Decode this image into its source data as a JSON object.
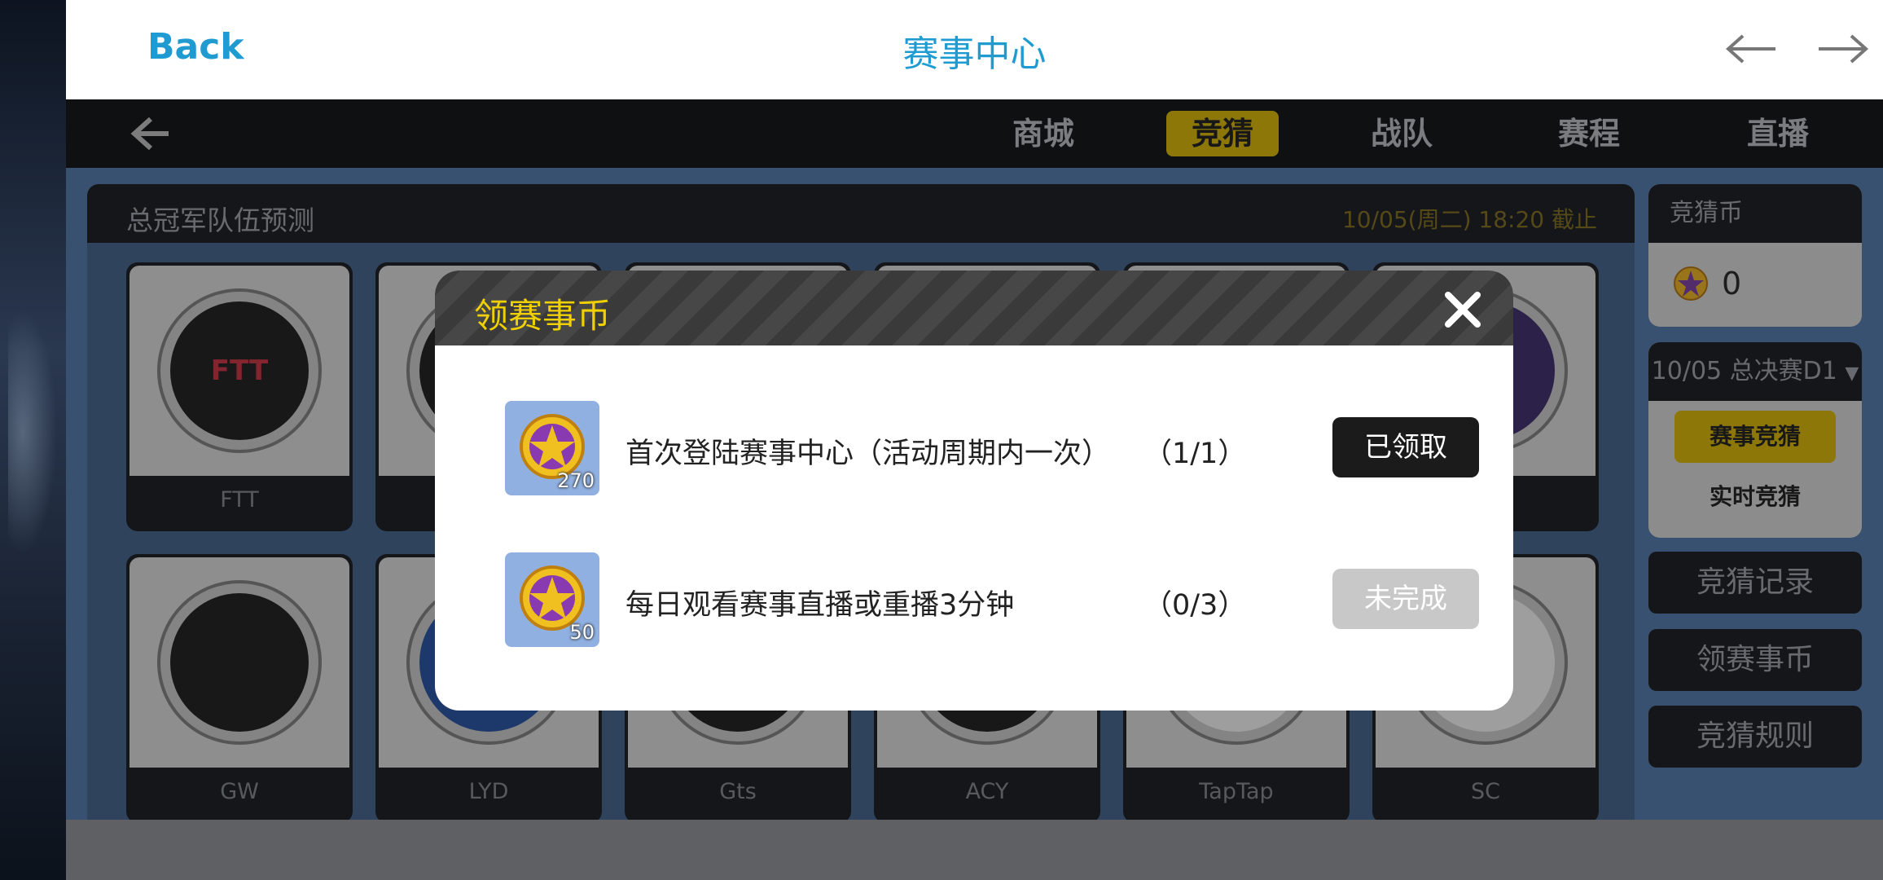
{
  "header": {
    "back_label": "Back",
    "title": "赛事中心"
  },
  "nav": {
    "tabs": [
      "商城",
      "竞猜",
      "战队",
      "赛程",
      "直播"
    ],
    "active_tab": "竞猜"
  },
  "panel": {
    "title": "总冠军队伍预测",
    "deadline": "10/05(周二) 18:20 截止"
  },
  "teams": {
    "row1": [
      "FTT",
      "",
      "",
      "",
      "",
      ""
    ],
    "row2": [
      "GW",
      "LYD",
      "Gts",
      "ACY",
      "TapTap",
      "SC"
    ]
  },
  "sidebar": {
    "coin_label": "竞猜币",
    "coin_value": "0",
    "match_select": "10/05 总决赛D1",
    "guess_mode_active": "赛事竞猜",
    "guess_mode_other": "实时竞猜",
    "buttons": [
      "竞猜记录",
      "领赛事币",
      "竞猜规则"
    ]
  },
  "modal": {
    "title": "领赛事币",
    "tasks": [
      {
        "reward": "270",
        "text": "首次登陆赛事中心（活动周期内一次）",
        "progress": "（1/1）",
        "button": "已领取",
        "state": "claimed"
      },
      {
        "reward": "50",
        "text": "每日观看赛事直播或重播3分钟",
        "progress": "（0/3）",
        "button": "未完成",
        "state": "incomplete"
      }
    ]
  },
  "colors": {
    "accent": "#1f9bd1",
    "gold": "#d5b400",
    "modal_title": "#f0d000"
  }
}
